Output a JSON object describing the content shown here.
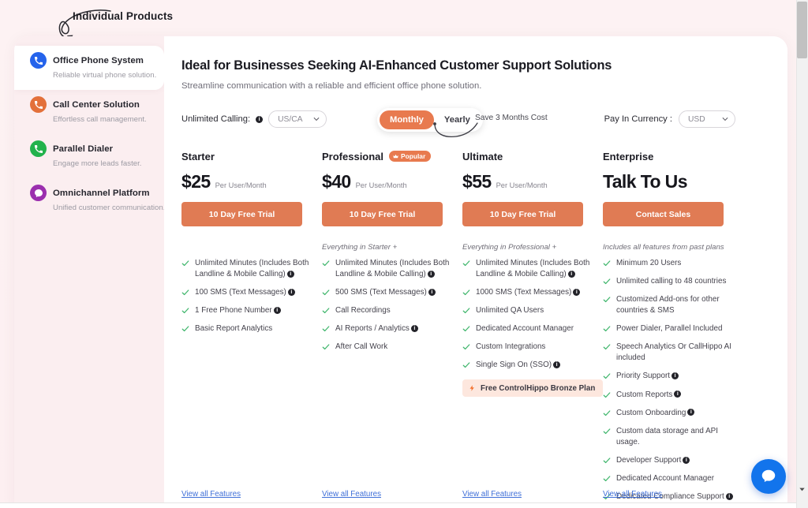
{
  "annotation": {
    "label": "Individual Products"
  },
  "sidebar": {
    "items": [
      {
        "title": "Office Phone System",
        "subtitle": "Reliable virtual phone solution.",
        "color": "#2563eb",
        "icon": "phone-icon",
        "active": true
      },
      {
        "title": "Call Center Solution",
        "subtitle": "Effortless call management.",
        "color": "#e3703a",
        "icon": "phone-icon",
        "active": false
      },
      {
        "title": "Parallel Dialer",
        "subtitle": "Engage more leads faster.",
        "color": "#22b24c",
        "icon": "phone-icon",
        "active": false
      },
      {
        "title": "Omnichannel Platform",
        "subtitle": "Unified customer communication.",
        "color": "#9b2fae",
        "icon": "chat-icon",
        "active": false
      }
    ]
  },
  "header": {
    "title": "Ideal for Businesses Seeking AI-Enhanced Customer Support Solutions",
    "subtitle": "Streamline communication with a reliable and efficient office phone solution."
  },
  "controls": {
    "calling_label": "Unlimited Calling:",
    "calling_value": "US/CA",
    "billing_monthly": "Monthly",
    "billing_yearly": "Yearly",
    "billing_selected": "Monthly",
    "save_note": "Save 3 Months Cost",
    "currency_label": "Pay In Currency :",
    "currency_value": "USD"
  },
  "view_all_label": "View all Features",
  "accent_color": "#e07b54",
  "tick_color": "#3db56a",
  "link_color": "#3f6fd8",
  "plans": [
    {
      "name": "Starter",
      "badge": null,
      "price": "$25",
      "price_unit": "Per User/Month",
      "cta": "10 Day Free Trial",
      "includes_note": "",
      "features": [
        {
          "text": "Unlimited Minutes (Includes Both Landline & Mobile Calling)",
          "info": true
        },
        {
          "text": "100 SMS (Text Messages)",
          "info": true
        },
        {
          "text": "1 Free Phone Number",
          "info": true
        },
        {
          "text": "Basic Report Analytics",
          "info": false
        }
      ],
      "bonus": null
    },
    {
      "name": "Professional",
      "badge": "Popular",
      "price": "$40",
      "price_unit": "Per User/Month",
      "cta": "10 Day Free Trial",
      "includes_note": "Everything in Starter +",
      "features": [
        {
          "text": "Unlimited Minutes (Includes Both Landline & Mobile Calling)",
          "info": true
        },
        {
          "text": "500 SMS (Text Messages)",
          "info": true
        },
        {
          "text": "Call Recordings",
          "info": false
        },
        {
          "text": "AI Reports / Analytics",
          "info": true
        },
        {
          "text": "After Call Work",
          "info": false
        }
      ],
      "bonus": null
    },
    {
      "name": "Ultimate",
      "badge": null,
      "price": "$55",
      "price_unit": "Per User/Month",
      "cta": "10 Day Free Trial",
      "includes_note": "Everything in Professional +",
      "features": [
        {
          "text": "Unlimited Minutes (Includes Both Landline & Mobile Calling)",
          "info": true
        },
        {
          "text": "1000 SMS (Text Messages)",
          "info": true
        },
        {
          "text": "Unlimited QA Users",
          "info": false
        },
        {
          "text": "Dedicated Account Manager",
          "info": false
        },
        {
          "text": "Custom Integrations",
          "info": false
        },
        {
          "text": "Single Sign On (SSO)",
          "info": true
        }
      ],
      "bonus": "Free ControlHippo Bronze Plan"
    },
    {
      "name": "Enterprise",
      "badge": null,
      "price": "Talk To Us",
      "price_unit": "",
      "cta": "Contact Sales",
      "includes_note": "Includes all features from past plans",
      "features": [
        {
          "text": "Minimum 20 Users",
          "info": false
        },
        {
          "text": "Unlimited calling to 48 countries",
          "info": false
        },
        {
          "text": "Customized Add-ons for other countries & SMS",
          "info": false
        },
        {
          "text": "Power Dialer, Parallel Included",
          "info": false
        },
        {
          "text": "Speech Analytics Or CallHippo AI included",
          "info": false
        },
        {
          "text": "Priority Support",
          "info": true
        },
        {
          "text": "Custom Reports",
          "info": true
        },
        {
          "text": "Custom Onboarding",
          "info": true
        },
        {
          "text": "Custom data storage and API usage.",
          "info": false
        },
        {
          "text": "Developer Support",
          "info": true
        },
        {
          "text": "Dedicated Account Manager",
          "info": false
        },
        {
          "text": "Dedicated Compliance Support",
          "info": true
        }
      ],
      "bonus": null
    }
  ],
  "chat_widget": {
    "icon": "chat-bubble-icon"
  }
}
